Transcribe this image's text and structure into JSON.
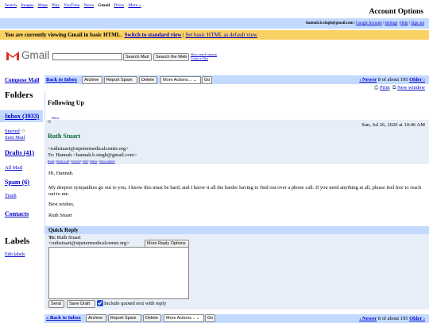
{
  "topnav": {
    "items": [
      "Search",
      "Images",
      "Maps",
      "Play",
      "YouTube",
      "News",
      "Gmail",
      "Drive",
      "More »"
    ],
    "current": "Gmail"
  },
  "account": {
    "title": "Account Options",
    "email": "hannah.b.singh@gmail.com",
    "links": [
      "Google Account",
      "Settings",
      "Help",
      "Sign out"
    ]
  },
  "notice": {
    "message": "You are currently viewing Gmail in basic HTML.",
    "switch_link": "Switch to standard view",
    "default_link": "Set basic HTML as default view"
  },
  "logo": {
    "word": "Gmail"
  },
  "search": {
    "value": "",
    "mail_button": "Search Mail",
    "web_button": "Search the Web",
    "options_link": "Show search options",
    "filter_link": "Create a filter"
  },
  "sidebar": {
    "compose": "Compose Mail",
    "folders_heading": "Folders",
    "inbox": "Inbox (3933)",
    "starred": "Starred",
    "sent": "Sent Mail",
    "drafts": "Drafts (41)",
    "all_mail": "All Mail",
    "spam": "Spam (6)",
    "trash": "Trash",
    "contacts": "Contacts",
    "labels_heading": "Labels",
    "edit_labels": "Edit labels"
  },
  "toolbar": {
    "back": "Back to Inbox",
    "back_bottom": "« Back to Inbox",
    "archive": "Archive",
    "report_spam": "Report Spam",
    "delete": "Delete",
    "more_actions": "More Actions...",
    "go": "Go",
    "newer": "‹ Newer",
    "count_text": "8 of about 195",
    "older": "Older ›",
    "print": "Print",
    "new_window": "New window"
  },
  "message": {
    "subject": "Following Up",
    "label_tag": "Inbox",
    "date": "Sun, Jul 26, 2020 at 10:46 AM",
    "sender_name": "Ruth Stuart",
    "sender_email": "<ruthstuart@stpetermedicalcenter.org>",
    "to_line": "To: Hannah <hannah.b.singh@gmail.com>",
    "reply_links": [
      "Reply",
      "Reply to all",
      "Forward",
      "Print",
      "Delete",
      "Show original"
    ],
    "greeting": "Hi, Hannah.",
    "body": "My deepest sympathies go out to you, I know this must be hard, and I know it all the harder having to find out over a phone call. If you need anything at all, please feel free to reach out to me.",
    "closing": "Best wishes,",
    "signature": "Ruth Stuart"
  },
  "quick_reply": {
    "title": "Quick Reply",
    "to_label": "To:",
    "to_name": "Ruth Stuart",
    "to_email": "<ruthstuart@stpetermedicalcenter.org>",
    "more_options": "More Reply Options",
    "value": "",
    "send": "Send",
    "save_draft": "Save Draft",
    "include_quoted": "Include quoted text with reply",
    "include_quoted_checked": true
  },
  "colors": {
    "bar_blue": "#c3d9ff",
    "notice_yellow": "#fad163",
    "header_gray_blue": "#e8eef7",
    "link_blue": "#0000cc",
    "sender_green": "#006633",
    "gmail_red": "#d93025"
  }
}
